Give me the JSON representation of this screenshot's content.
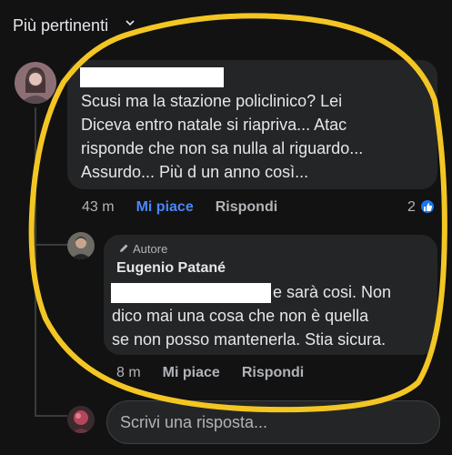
{
  "header": {
    "sort_label": "Più pertinenti"
  },
  "comment": {
    "text_line1": "Scusi ma la stazione policlinico? Lei",
    "text_line2": "Diceva entro natale si riapriva... Atac",
    "text_line3": "risponde che non sa nulla al riguardo...",
    "text_line4": "Assurdo... Più d un anno così...",
    "time": "43 m",
    "like_label": "Mi piace",
    "reply_label": "Rispondi",
    "reaction_count": "2"
  },
  "reply": {
    "badge_label": "Autore",
    "author_name": "Eugenio Patané",
    "text_line1_tail": "e sarà cosi. Non",
    "text_line2": "dico mai una cosa che non è quella",
    "text_line3": "se non posso mantenerla. Stia sicura.",
    "time": "8 m",
    "like_label": "Mi piace",
    "reply_label": "Rispondi"
  },
  "composer": {
    "placeholder": "Scrivi una risposta..."
  },
  "colors": {
    "accent": "#4a86f7",
    "highlight": "#f3c623",
    "background": "#121212",
    "bubble": "#242526"
  }
}
